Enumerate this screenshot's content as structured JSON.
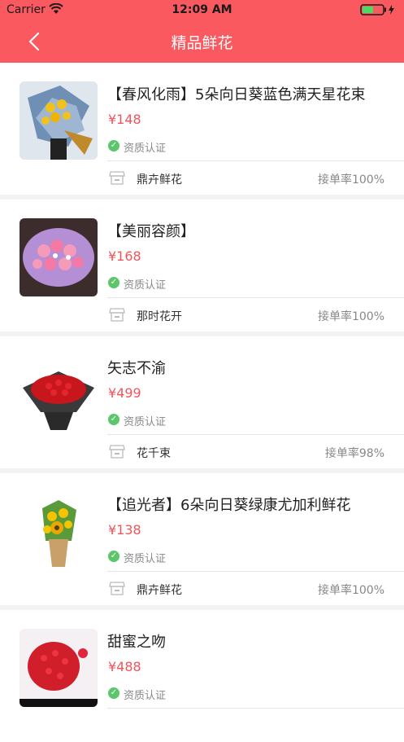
{
  "status_bar": {
    "carrier": "Carrier",
    "time": "12:09 AM",
    "battery_level": 0.5
  },
  "nav": {
    "title": "精品鲜花",
    "back_icon": "chevron-left-icon"
  },
  "colors": {
    "header": "#f9595f",
    "price": "#f2545b",
    "cert_badge": "#5cc66b"
  },
  "products": [
    {
      "name": "【春风化雨】5朵向日葵蓝色满天星花束",
      "price": "¥148",
      "cert": "资质认证",
      "shop": "鼎卉鲜花",
      "rate": "接单率100%"
    },
    {
      "name": "【美丽容颜】",
      "price": "¥168",
      "cert": "资质认证",
      "shop": "那时花开",
      "rate": "接单率100%"
    },
    {
      "name": "矢志不渝",
      "price": "¥499",
      "cert": "资质认证",
      "shop": "花千束",
      "rate": "接单率98%"
    },
    {
      "name": "【追光者】6朵向日葵绿康尤加利鲜花",
      "price": "¥138",
      "cert": "资质认证",
      "shop": "鼎卉鲜花",
      "rate": "接单率100%"
    },
    {
      "name": "甜蜜之吻",
      "price": "¥488",
      "cert": "资质认证",
      "shop": "",
      "rate": ""
    }
  ]
}
